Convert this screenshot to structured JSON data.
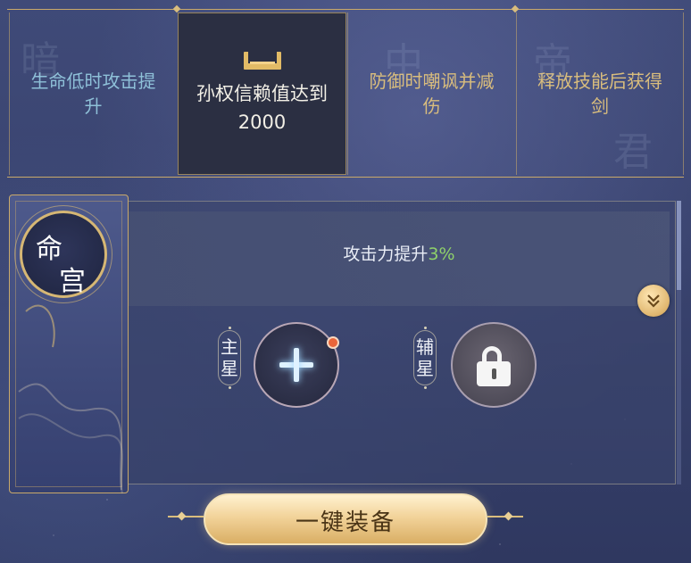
{
  "top_cards": [
    {
      "label": "生命低时攻击提升",
      "selected": false
    },
    {
      "label": "孙权信赖值达到2000",
      "selected": true,
      "icon": "tray-icon"
    },
    {
      "label": "防御时嘲讽并减伤",
      "selected": false
    },
    {
      "label": "释放技能后获得剑",
      "selected": false
    }
  ],
  "banner": {
    "title_1": "命",
    "title_2": "宫"
  },
  "attribute": {
    "text": "攻击力提升",
    "value": "3%",
    "value_color": "#8fd16a"
  },
  "slots": {
    "main": {
      "label_1": "主",
      "label_2": "星",
      "state": "empty",
      "icon": "plus-icon",
      "has_notification": true
    },
    "aux": {
      "label_1": "辅",
      "label_2": "星",
      "state": "locked",
      "icon": "lock-icon"
    }
  },
  "expand_icon": "double-chevron-down-icon",
  "equip_button": {
    "label": "一键装备"
  },
  "colors": {
    "accent_gold": "#d9bd7d",
    "skill_blue": "#8ec0d8",
    "notification": "#e9653a"
  }
}
